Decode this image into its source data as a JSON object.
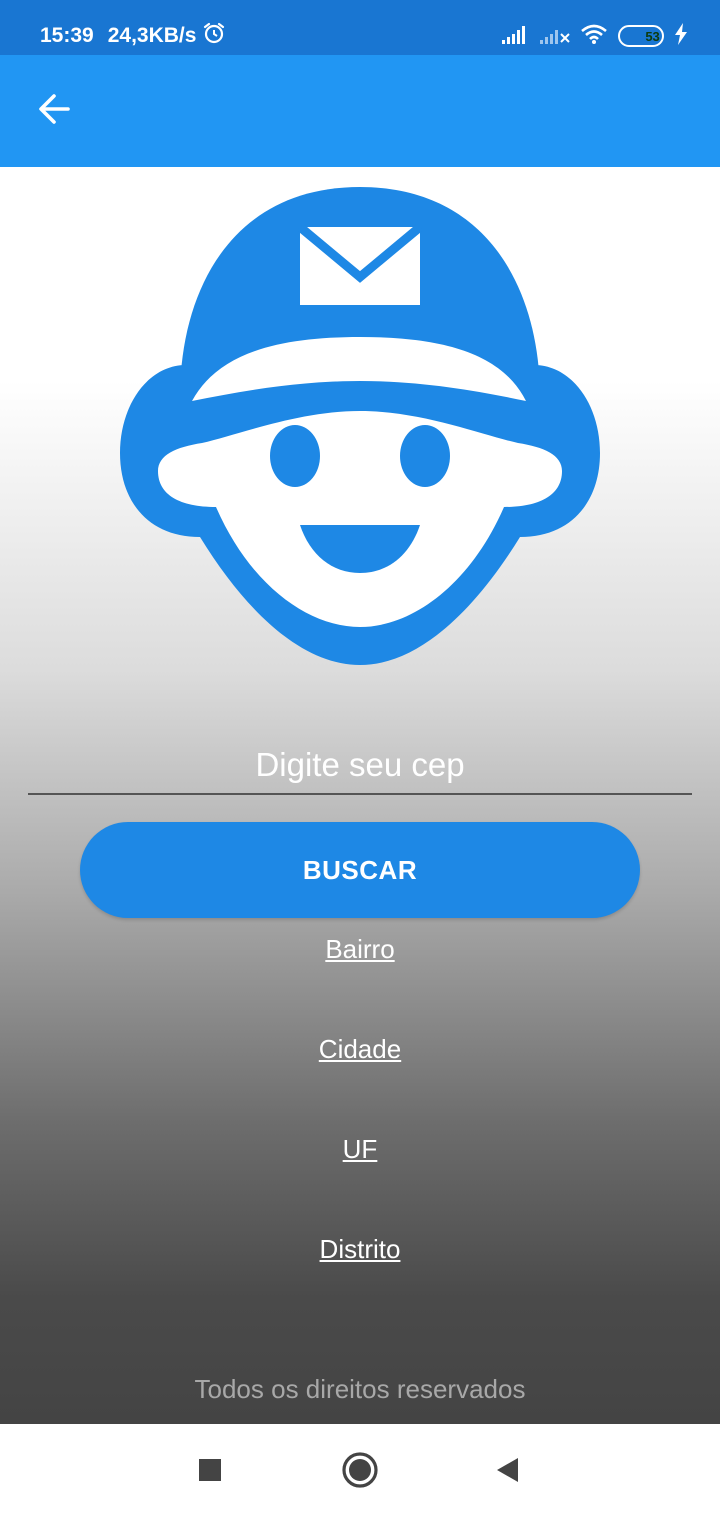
{
  "status_bar": {
    "time": "15:39",
    "net_speed": "24,3KB/s",
    "battery_level": "53",
    "icons": [
      "alarm-icon",
      "signal-icon",
      "signal-no-service-icon",
      "wifi-icon",
      "battery-icon",
      "charging-icon"
    ]
  },
  "app_bar": {
    "back_icon": "arrow-back-icon"
  },
  "mascot": {
    "icon": "postman-mascot-icon",
    "color": "#1e88e5"
  },
  "search": {
    "placeholder": "Digite seu cep",
    "value": ""
  },
  "buscar_label": "BUSCAR",
  "results": {
    "bairro": "Bairro",
    "cidade": "Cidade",
    "uf": "UF",
    "distrito": "Distrito"
  },
  "footer": "Todos os direitos reservados",
  "nav": {
    "recents_icon": "square-icon",
    "home_icon": "circle-icon",
    "back_icon": "triangle-back-icon"
  },
  "colors": {
    "status_bar": "#1976d2",
    "app_bar": "#2196f3",
    "accent": "#1e88e5"
  }
}
